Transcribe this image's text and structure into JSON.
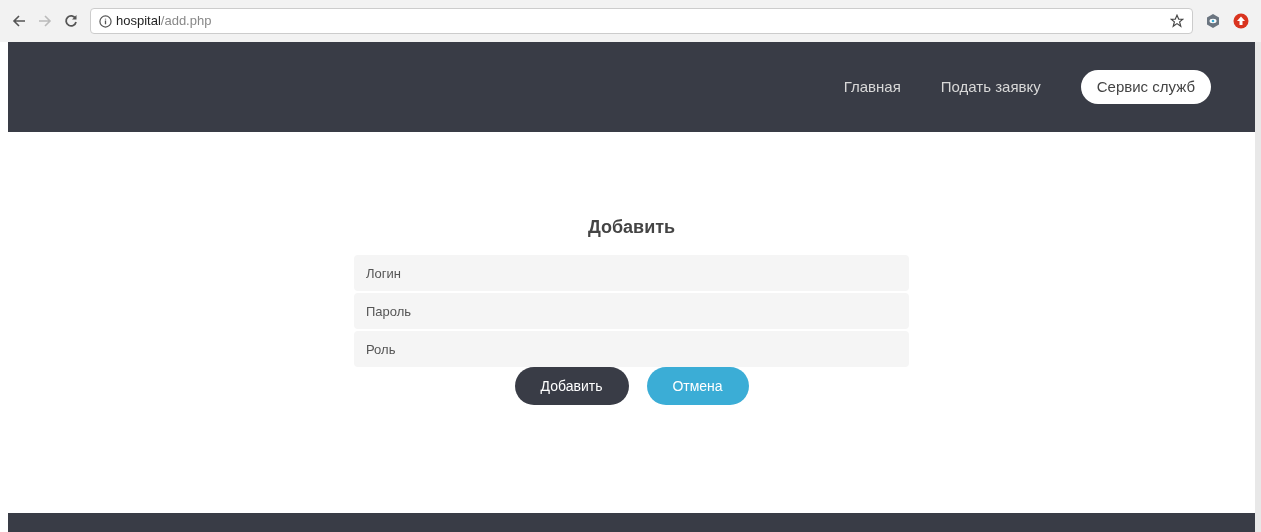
{
  "browser": {
    "url_host": "hospital",
    "url_path": "/add.php"
  },
  "nav": {
    "items": [
      {
        "label": "Главная",
        "selected": false
      },
      {
        "label": "Подать заявку",
        "selected": false
      },
      {
        "label": "Сервис служб",
        "selected": true
      }
    ]
  },
  "form": {
    "title": "Добавить",
    "fields": [
      {
        "placeholder": "Логин"
      },
      {
        "placeholder": "Пароль"
      },
      {
        "placeholder": "Роль"
      }
    ],
    "buttons": [
      {
        "label": "Добавить",
        "kind": "primary"
      },
      {
        "label": "Отмена",
        "kind": "secondary"
      }
    ]
  }
}
